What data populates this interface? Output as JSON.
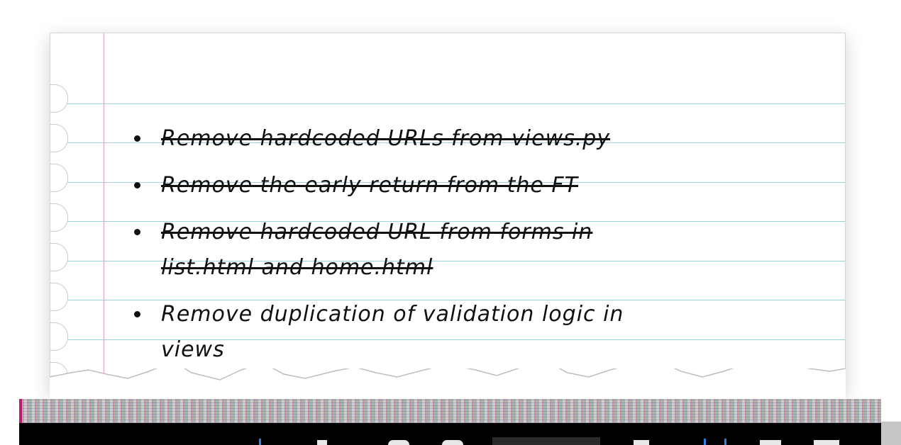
{
  "todo_list": {
    "items": [
      {
        "text": "Remove hardcoded URLs from views.py",
        "done": true
      },
      {
        "text": "Remove the early return from the FT",
        "done": true
      },
      {
        "text": "Remove hardcoded URL from forms in list.html and home.html",
        "done": true
      },
      {
        "text": "Remove duplication of validation logic in views",
        "done": false
      }
    ]
  },
  "colors": {
    "paper": "#ffffff",
    "rule_line": "#9fd3dc",
    "margin_line": "#e8a0b8",
    "ink": "#111111"
  },
  "icons": [
    "torn-paper-edge",
    "binder-hole"
  ]
}
